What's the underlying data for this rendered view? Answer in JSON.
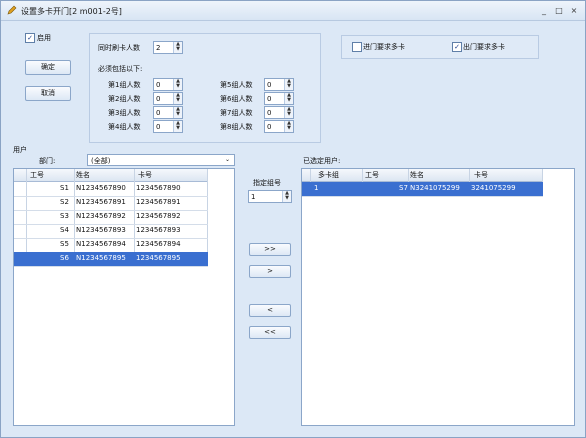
{
  "window": {
    "title": "设置多卡开门[2    m001-2号]",
    "minimize": "_",
    "maximize": "□",
    "close": "×"
  },
  "top": {
    "enabled_label": "启用",
    "enabled_checked": true,
    "ok_label": "确定",
    "cancel_label": "取消",
    "simul_label": "同时刷卡人数",
    "simul_value": "2",
    "must_include_label": "必须包括以下:",
    "groups": [
      {
        "label": "第1组人数",
        "value": "0"
      },
      {
        "label": "第2组人数",
        "value": "0"
      },
      {
        "label": "第3组人数",
        "value": "0"
      },
      {
        "label": "第4组人数",
        "value": "0"
      },
      {
        "label": "第5组人数",
        "value": "0"
      },
      {
        "label": "第6组人数",
        "value": "0"
      },
      {
        "label": "第7组人数",
        "value": "0"
      },
      {
        "label": "第8组人数",
        "value": "0"
      }
    ],
    "in_multicard_label": "进门要求多卡",
    "in_multicard_checked": false,
    "out_multicard_label": "出门要求多卡",
    "out_multicard_checked": true
  },
  "users": {
    "section_label": "用户",
    "dept_label": "部门:",
    "dept_value": "(全部)",
    "columns": [
      "工号",
      "姓名",
      "卡号"
    ],
    "rows": [
      {
        "id": "S1",
        "name": "N1234567890",
        "card": "1234567890"
      },
      {
        "id": "S2",
        "name": "N1234567891",
        "card": "1234567891"
      },
      {
        "id": "S3",
        "name": "N1234567892",
        "card": "1234567892"
      },
      {
        "id": "S4",
        "name": "N1234567893",
        "card": "1234567893"
      },
      {
        "id": "S5",
        "name": "N1234567894",
        "card": "1234567894"
      },
      {
        "id": "S6",
        "name": "N1234567895",
        "card": "1234567895"
      }
    ],
    "selected_index": 5
  },
  "middle": {
    "group_label": "指定组号",
    "group_value": "1",
    "add_all": ">>",
    "add_one": ">",
    "remove_one": "<",
    "remove_all": "<<"
  },
  "selected": {
    "section_label": "已选定用户:",
    "columns": [
      "多卡组",
      "工号",
      "姓名",
      "卡号"
    ],
    "rows": [
      {
        "group": "1",
        "id": "S7",
        "name": "N3241075299",
        "card": "3241075299"
      }
    ]
  }
}
